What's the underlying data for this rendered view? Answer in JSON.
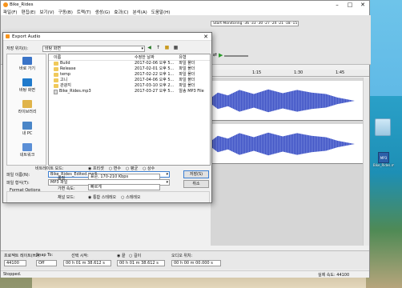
{
  "window": {
    "title": "Bike_Rides"
  },
  "menu": [
    "파일(F)",
    "편집(E)",
    "보기(V)",
    "구동(B)",
    "트랙(T)",
    "생성(G)",
    "효과(C)",
    "분석(A)",
    "도움말(H)"
  ],
  "meter_text": "Start Monitoring ·36 ·33 ·30 ·27 ·24 ·21 ·18 ·15 ·12 ·9 ·6 ·3 0",
  "ruler": [
    "1:15",
    "1:30",
    "1:45"
  ],
  "dialog": {
    "title": "Export Audio",
    "look_in_label": "저장 위치(I):",
    "look_in_value": "바탕 화면",
    "columns": [
      "이름",
      "수정한 날짜",
      "유형"
    ],
    "files": [
      {
        "name": "Build",
        "date": "2017-02-06 오후 5...",
        "type": "파일 폴더",
        "kind": "folder"
      },
      {
        "name": "Release",
        "date": "2017-02-01 오후 5...",
        "type": "파일 폴더",
        "kind": "folder"
      },
      {
        "name": "temp",
        "date": "2017-02-22 오후 1...",
        "type": "파일 폴더",
        "kind": "folder"
      },
      {
        "name": "고니",
        "date": "2017-04-06 오후 5...",
        "type": "파일 폴더",
        "kind": "folder"
      },
      {
        "name": "관광지",
        "date": "2017-03-10 오후 2...",
        "type": "파일 폴더",
        "kind": "folder"
      },
      {
        "name": "Bike_Rides.mp3",
        "date": "2017-03-27 오후 5...",
        "type": "알송 MP3 File",
        "kind": "mp3"
      }
    ],
    "places": [
      "바로 가기",
      "바탕 화면",
      "라이브러리",
      "내 PC",
      "네트워크"
    ],
    "filename_label": "파일 이름(N):",
    "filename_value": "Bike_Rides_Edited.mp3",
    "filetype_label": "파일 형식(T):",
    "filetype_value": "MP3 파일",
    "save_button": "저장(S)",
    "cancel_button": "취소",
    "format_options_title": "Format Options",
    "options": {
      "bitrate_mode_label": "비트레이트 모드:",
      "bitrate_modes": [
        "프리셋",
        "변수",
        "평균",
        "상수"
      ],
      "quality_label": "품질",
      "quality_value": "표준, 170-210 Kbps",
      "speed_label": "가변 속도:",
      "speed_value": "빠르게",
      "channel_label": "채널 모드:",
      "channel_modes": [
        "통합 스테레오",
        "스테레오"
      ]
    }
  },
  "selection_bar": {
    "rate_label": "프로젝트 레이트(Hz):",
    "rate_value": "44100",
    "snap_label": "Snap To:",
    "snap_value": "Off",
    "start_label": "선택 시작:",
    "start_value": "00 h 01 m 38.612 s",
    "end_value": "00 h 01 m 38.612 s",
    "end_radio": "끝",
    "length_radio": "길이",
    "pos_label": "오디오 위치:",
    "pos_value": "00 h 00 m 00.000 s"
  },
  "status": {
    "left": "Stopped.",
    "right": "실제 속도: 44100"
  },
  "desktop_icons": [
    "Bike_Rides.mp3"
  ],
  "accent": "#3c7fd1"
}
